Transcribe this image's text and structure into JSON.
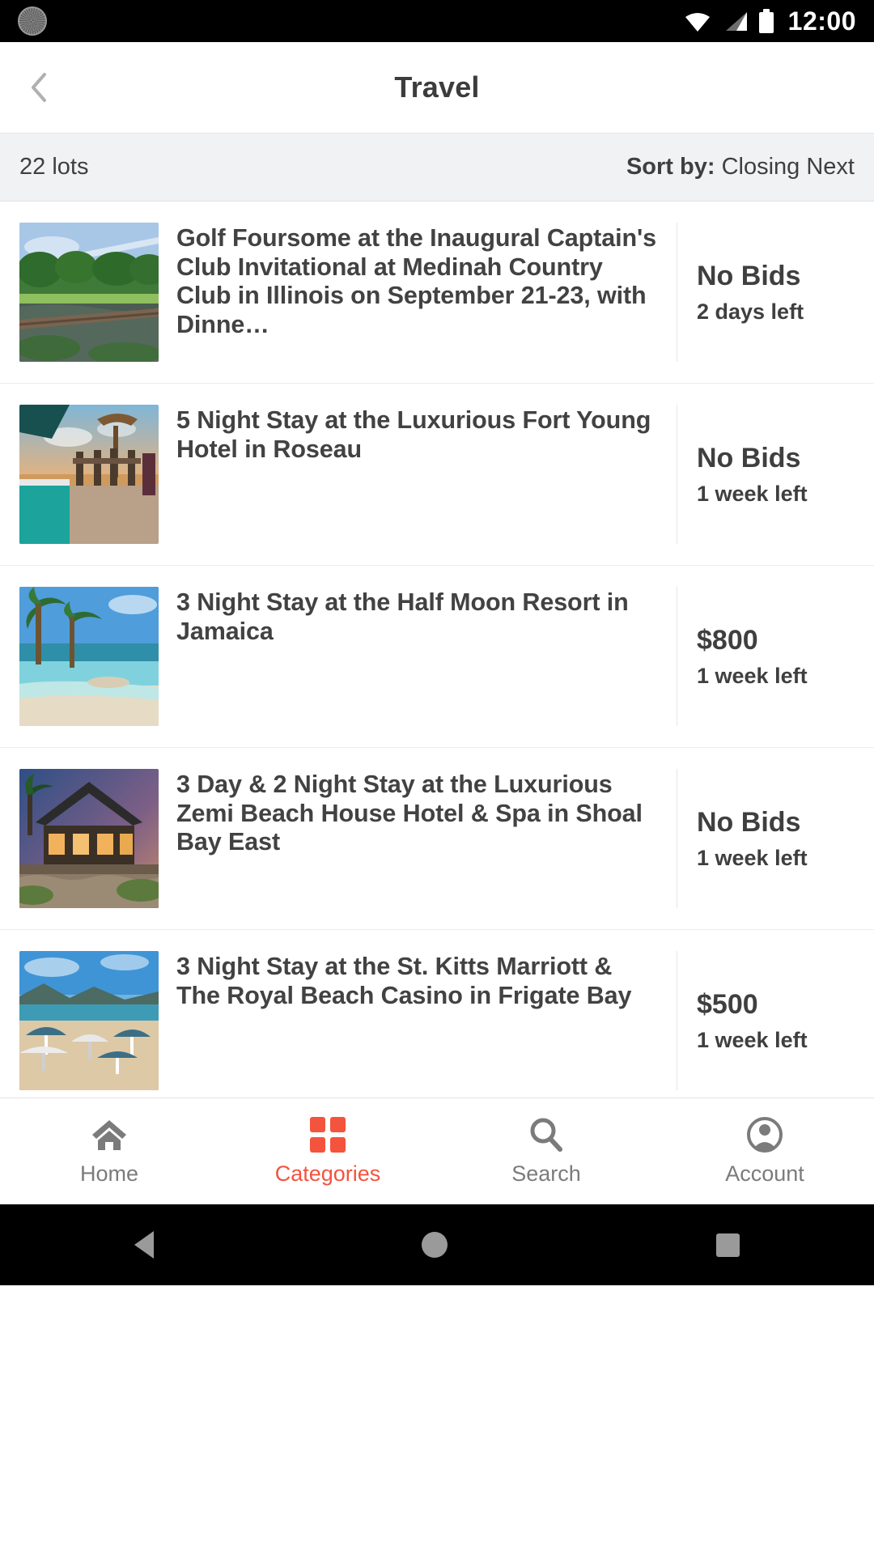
{
  "status_bar": {
    "time": "12:00",
    "icons": [
      "app-badge-icon",
      "wifi-icon",
      "cellular-signal-icon",
      "battery-icon"
    ]
  },
  "header": {
    "title": "Travel",
    "back_icon": "chevron-left-icon"
  },
  "sort_bar": {
    "lots_count": "22 lots",
    "sort_label": "Sort by:",
    "sort_value": "Closing Next"
  },
  "colors": {
    "accent": "#f4533d",
    "text_primary": "#424242",
    "text_muted": "#7b7b7b",
    "sortbar_bg": "#f1f2f4",
    "status_bar_bg": "#000000"
  },
  "lots": [
    {
      "title": "Golf Foursome at the Inaugural Captain's Club Invitational at Medinah Country Club in Illinois on September 21-23, with Dinne…",
      "bid": "No Bids",
      "time_left": "2 days left",
      "thumb": "golf-course-lake-photo"
    },
    {
      "title": "5 Night Stay at the Luxurious Fort Young Hotel in Roseau",
      "bid": "No Bids",
      "time_left": "1 week left",
      "thumb": "beach-bar-sunset-photo"
    },
    {
      "title": "3 Night Stay at the Half Moon Resort in Jamaica",
      "bid": "$800",
      "time_left": "1 week left",
      "thumb": "palm-beach-shore-photo"
    },
    {
      "title": "3 Day & 2 Night Stay at the Luxurious Zemi Beach House Hotel & Spa in Shoal Bay East",
      "bid": "No Bids",
      "time_left": "1 week left",
      "thumb": "resort-villa-dusk-photo"
    },
    {
      "title": "3 Night Stay at the St. Kitts Marriott & The Royal Beach Casino in Frigate Bay",
      "bid": "$500",
      "time_left": "1 week left",
      "thumb": "beach-umbrellas-photo"
    }
  ],
  "tabs": [
    {
      "label": "Home",
      "icon": "home-icon",
      "active": false
    },
    {
      "label": "Categories",
      "icon": "grid-icon",
      "active": true
    },
    {
      "label": "Search",
      "icon": "search-icon",
      "active": false
    },
    {
      "label": "Account",
      "icon": "account-icon",
      "active": false
    }
  ],
  "system_nav": {
    "back": "triangle-back-icon",
    "home": "circle-home-icon",
    "recents": "square-recents-icon"
  }
}
